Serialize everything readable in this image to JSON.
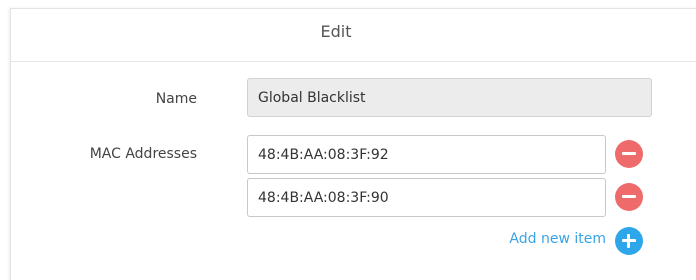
{
  "dialog": {
    "title": "Edit"
  },
  "form": {
    "name_label": "Name",
    "name_value": "Global Blacklist",
    "mac_label": "MAC Addresses",
    "mac_addresses": [
      "48:4B:AA:08:3F:92",
      "48:4B:AA:08:3F:90"
    ],
    "add_item_label": "Add new item"
  },
  "colors": {
    "remove_button": "#ef6b6b",
    "add_button": "#2ea7ea",
    "link": "#3aa3e3"
  },
  "icons": {
    "remove": "minus-circle-icon",
    "add": "plus-circle-icon"
  }
}
